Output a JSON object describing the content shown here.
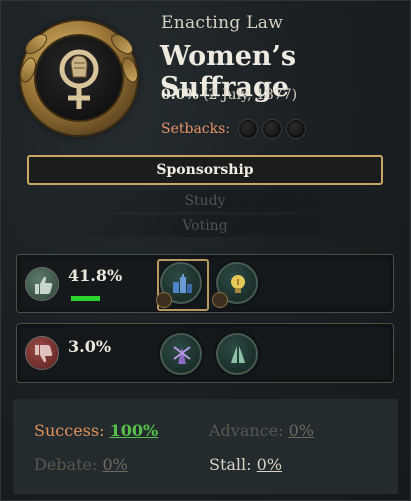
{
  "header": {
    "eyebrow": "Enacting Law",
    "title": "Women’s Suffrage",
    "progress_pct": "0.0%",
    "progress_date": "(2 July, 1877)",
    "setbacks_label": "Setbacks:",
    "setbacks": [
      false,
      false,
      false
    ]
  },
  "stages": [
    {
      "label": "Sponsorship",
      "active": true
    },
    {
      "label": "Study",
      "active": false
    },
    {
      "label": "Voting",
      "active": false
    }
  ],
  "support": {
    "value": "41.8%",
    "approval_fraction": 1.0,
    "groups": [
      {
        "icon": "industrialists-icon",
        "color": "#3d6aa8"
      },
      {
        "icon": "intelligentsia-icon",
        "color": "#d8b84a"
      }
    ]
  },
  "oppose": {
    "value": "3.0%",
    "groups": [
      {
        "icon": "rural-folk-icon",
        "color": "#8a6ac2"
      },
      {
        "icon": "devout-icon",
        "color": "#8fc2a4"
      }
    ]
  },
  "odds": {
    "success_label": "Success:",
    "success_value": "100%",
    "advance_label": "Advance:",
    "advance_value": "0%",
    "debate_label": "Debate:",
    "debate_value": "0%",
    "stall_label": "Stall:",
    "stall_value": "0%"
  },
  "colors": {
    "accent_gold": "#c9a865",
    "success_green": "#57c04a",
    "label_orange": "#e0925a"
  }
}
